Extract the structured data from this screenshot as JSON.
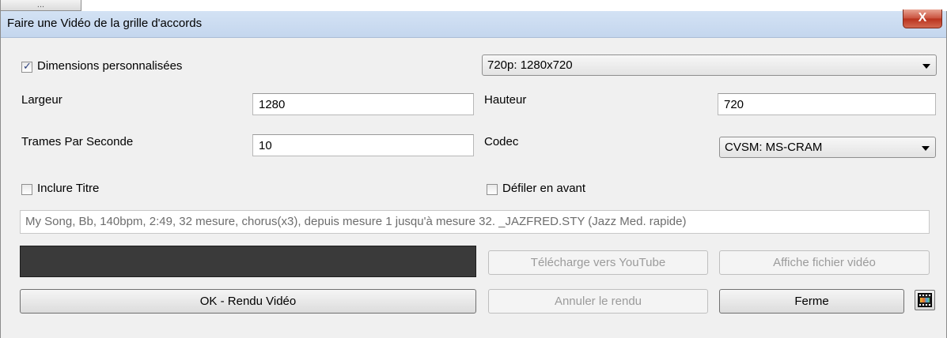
{
  "tab_stub": "...",
  "window": {
    "title": "Faire une Vidéo de la grille d'accords",
    "close_label": "X"
  },
  "custom_dimensions": {
    "label": "Dimensions personnalisées",
    "checked": true
  },
  "preset": {
    "selected": "720p: 1280x720"
  },
  "width": {
    "label": "Largeur",
    "value": "1280"
  },
  "height": {
    "label": "Hauteur",
    "value": "720"
  },
  "fps": {
    "label": "Trames Par Seconde",
    "value": "10"
  },
  "codec": {
    "label": "Codec",
    "selected": "CVSM: MS-CRAM"
  },
  "include_title": {
    "label": "Inclure Titre",
    "checked": false
  },
  "scroll_forward": {
    "label": "Défiler en avant",
    "checked": false
  },
  "summary_text": "My Song, Bb, 140bpm, 2:49, 32 mesure, chorus(x3), depuis mesure 1 jusqu'à mesure 32. _JAZFRED.STY (Jazz Med. rapide)",
  "progress_fraction": 0,
  "buttons": {
    "upload_youtube": "Télécharge vers YouTube",
    "show_video_file": "Affiche fichier vidéo",
    "render_ok": "OK - Rendu Vidéo",
    "cancel_render": "Annuler le rendu",
    "close": "Ferme"
  },
  "icons": {
    "video_settings": "film-icon"
  },
  "colors": {
    "titlebar": "#c9daf0",
    "close_button": "#c9503c",
    "progress_track": "#3a3a3a"
  }
}
